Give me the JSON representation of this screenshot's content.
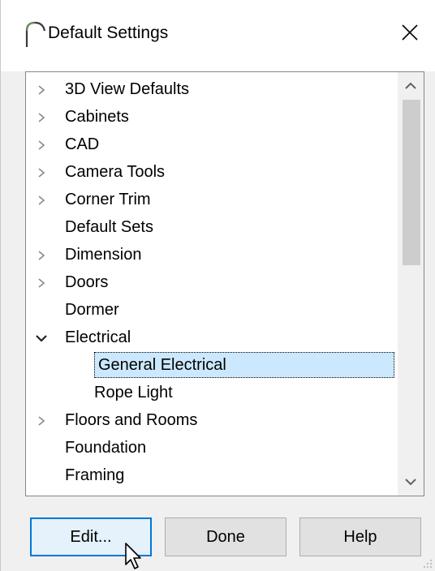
{
  "window": {
    "title": "Default Settings",
    "close_glyph": "✕",
    "icon": "arch-icon"
  },
  "tree": {
    "items": [
      {
        "label": "3D View Defaults",
        "expander": "collapsed",
        "level": 0
      },
      {
        "label": "Cabinets",
        "expander": "collapsed",
        "level": 0
      },
      {
        "label": "CAD",
        "expander": "collapsed",
        "level": 0
      },
      {
        "label": "Camera Tools",
        "expander": "collapsed",
        "level": 0
      },
      {
        "label": "Corner Trim",
        "expander": "collapsed",
        "level": 0
      },
      {
        "label": "Default Sets",
        "expander": "none",
        "level": 0
      },
      {
        "label": "Dimension",
        "expander": "collapsed",
        "level": 0
      },
      {
        "label": "Doors",
        "expander": "collapsed",
        "level": 0
      },
      {
        "label": "Dormer",
        "expander": "none",
        "level": 0
      },
      {
        "label": "Electrical",
        "expander": "expanded",
        "level": 0
      },
      {
        "label": "General Electrical",
        "expander": "none",
        "level": 1,
        "selected": true
      },
      {
        "label": "Rope Light",
        "expander": "none",
        "level": 1
      },
      {
        "label": "Floors and Rooms",
        "expander": "collapsed",
        "level": 0
      },
      {
        "label": "Foundation",
        "expander": "none",
        "level": 0
      },
      {
        "label": "Framing",
        "expander": "none",
        "level": 0
      }
    ]
  },
  "buttons": {
    "edit": "Edit...",
    "done": "Done",
    "help": "Help"
  },
  "colors": {
    "selection": "#cce8ff",
    "focus_border": "#0078d7"
  }
}
